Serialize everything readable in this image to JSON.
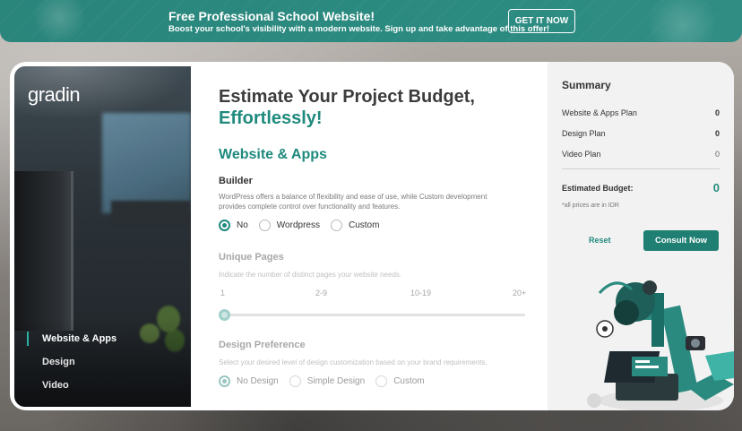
{
  "banner": {
    "title": "Free Professional School Website!",
    "subtitle": "Boost your school's visibility with a modern website. Sign up and take advantage of this offer!",
    "cta": "GET IT NOW"
  },
  "sidebar": {
    "logo": "gradin",
    "items": [
      {
        "label": "Website & Apps",
        "active": true
      },
      {
        "label": "Design",
        "active": false
      },
      {
        "label": "Video",
        "active": false
      }
    ]
  },
  "main": {
    "title_line1": "Estimate Your Project Budget,",
    "title_line2": "Effortlessly!",
    "section": "Website & Apps",
    "builder": {
      "label": "Builder",
      "description": "WordPress offers a balance of flexibility and ease of use, while Custom development provides complete control over functionality and features.",
      "options": [
        "No",
        "Wordpress",
        "Custom"
      ],
      "selected": "No"
    },
    "unique_pages": {
      "label": "Unique Pages",
      "description": "Indicate the number of distinct pages your website needs.",
      "ticks": [
        "1",
        "2-9",
        "10-19",
        "20+"
      ],
      "value": "1"
    },
    "design_preference": {
      "label": "Design Preference",
      "description": "Select your desired level of design customization based on your brand requirements.",
      "options": [
        "No Design",
        "Simple Design",
        "Custom"
      ],
      "selected": "No Design"
    }
  },
  "summary": {
    "title": "Summary",
    "rows": [
      {
        "label": "Website & Apps Plan",
        "value": "0"
      },
      {
        "label": "Design Plan",
        "value": "0"
      },
      {
        "label": "Video Plan",
        "value": "0"
      }
    ],
    "estimated_label": "Estimated Budget:",
    "estimated_value": "0",
    "note": "*all prices are in IDR",
    "reset_label": "Reset",
    "consult_label": "Consult Now"
  },
  "colors": {
    "accent": "#1f8a7d",
    "banner": "#2b8a80",
    "button": "#1f7f73"
  }
}
